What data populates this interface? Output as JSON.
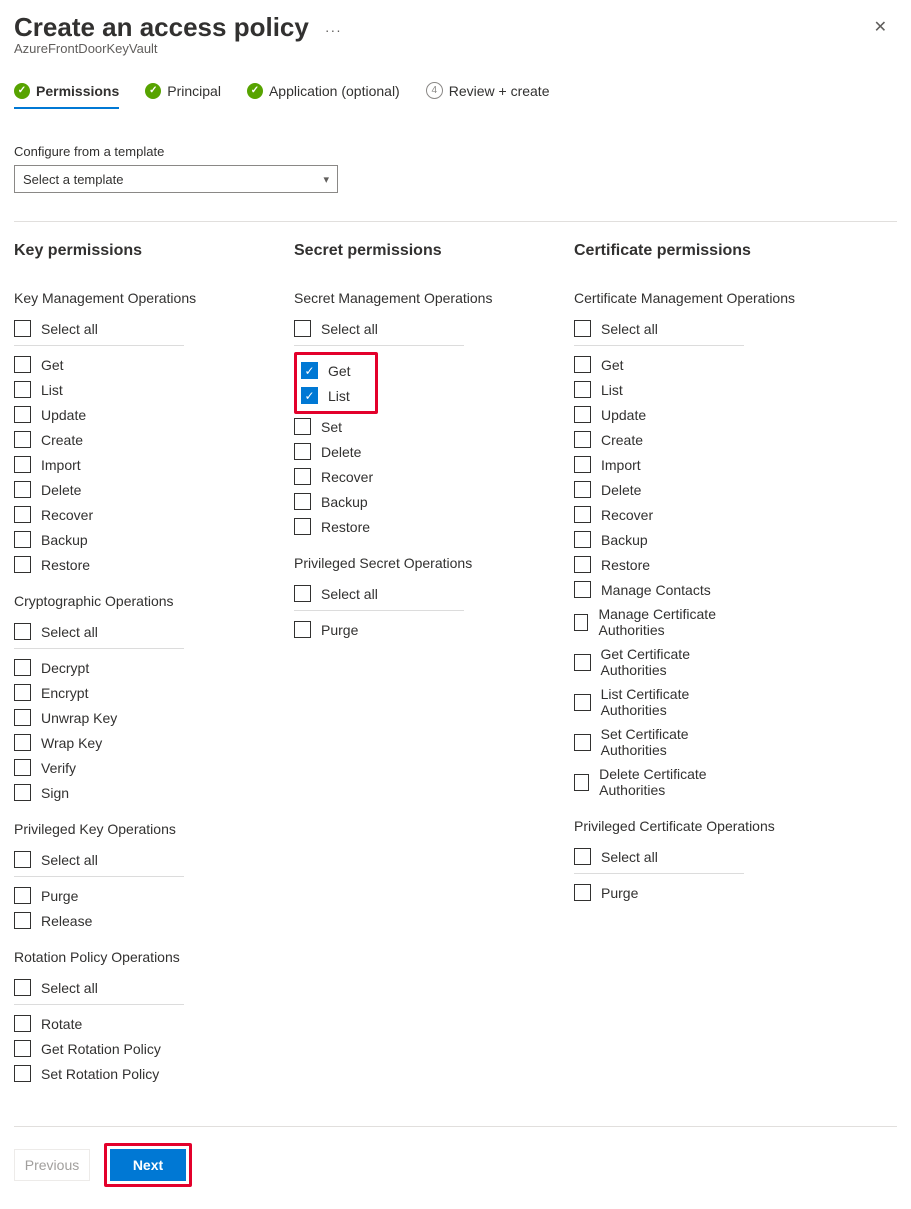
{
  "header": {
    "title": "Create an access policy",
    "subtitle": "AzureFrontDoorKeyVault"
  },
  "tabs": [
    {
      "label": "Permissions",
      "state": "done",
      "active": true
    },
    {
      "label": "Principal",
      "state": "done",
      "active": false
    },
    {
      "label": "Application (optional)",
      "state": "done",
      "active": false
    },
    {
      "label": "Review + create",
      "state": "pending",
      "num": "4",
      "active": false
    }
  ],
  "template": {
    "label": "Configure from a template",
    "select_placeholder": "Select a template"
  },
  "columns": {
    "key": {
      "title": "Key permissions",
      "groups": [
        {
          "title": "Key Management Operations",
          "select_all": "Select all",
          "items": [
            {
              "label": "Get",
              "checked": false
            },
            {
              "label": "List",
              "checked": false
            },
            {
              "label": "Update",
              "checked": false
            },
            {
              "label": "Create",
              "checked": false
            },
            {
              "label": "Import",
              "checked": false
            },
            {
              "label": "Delete",
              "checked": false
            },
            {
              "label": "Recover",
              "checked": false
            },
            {
              "label": "Backup",
              "checked": false
            },
            {
              "label": "Restore",
              "checked": false
            }
          ]
        },
        {
          "title": "Cryptographic Operations",
          "select_all": "Select all",
          "items": [
            {
              "label": "Decrypt",
              "checked": false
            },
            {
              "label": "Encrypt",
              "checked": false
            },
            {
              "label": "Unwrap Key",
              "checked": false
            },
            {
              "label": "Wrap Key",
              "checked": false
            },
            {
              "label": "Verify",
              "checked": false
            },
            {
              "label": "Sign",
              "checked": false
            }
          ]
        },
        {
          "title": "Privileged Key Operations",
          "select_all": "Select all",
          "items": [
            {
              "label": "Purge",
              "checked": false
            },
            {
              "label": "Release",
              "checked": false
            }
          ]
        },
        {
          "title": "Rotation Policy Operations",
          "select_all": "Select all",
          "items": [
            {
              "label": "Rotate",
              "checked": false
            },
            {
              "label": "Get Rotation Policy",
              "checked": false
            },
            {
              "label": "Set Rotation Policy",
              "checked": false
            }
          ]
        }
      ]
    },
    "secret": {
      "title": "Secret permissions",
      "groups": [
        {
          "title": "Secret Management Operations",
          "select_all": "Select all",
          "highlight": true,
          "items": [
            {
              "label": "Get",
              "checked": true
            },
            {
              "label": "List",
              "checked": true
            },
            {
              "label": "Set",
              "checked": false
            },
            {
              "label": "Delete",
              "checked": false
            },
            {
              "label": "Recover",
              "checked": false
            },
            {
              "label": "Backup",
              "checked": false
            },
            {
              "label": "Restore",
              "checked": false
            }
          ],
          "highlight_count": 2
        },
        {
          "title": "Privileged Secret Operations",
          "select_all": "Select all",
          "items": [
            {
              "label": "Purge",
              "checked": false
            }
          ]
        }
      ]
    },
    "cert": {
      "title": "Certificate permissions",
      "groups": [
        {
          "title": "Certificate Management Operations",
          "select_all": "Select all",
          "items": [
            {
              "label": "Get",
              "checked": false
            },
            {
              "label": "List",
              "checked": false
            },
            {
              "label": "Update",
              "checked": false
            },
            {
              "label": "Create",
              "checked": false
            },
            {
              "label": "Import",
              "checked": false
            },
            {
              "label": "Delete",
              "checked": false
            },
            {
              "label": "Recover",
              "checked": false
            },
            {
              "label": "Backup",
              "checked": false
            },
            {
              "label": "Restore",
              "checked": false
            },
            {
              "label": "Manage Contacts",
              "checked": false
            },
            {
              "label": "Manage Certificate Authorities",
              "checked": false
            },
            {
              "label": "Get Certificate Authorities",
              "checked": false
            },
            {
              "label": "List Certificate Authorities",
              "checked": false
            },
            {
              "label": "Set Certificate Authorities",
              "checked": false
            },
            {
              "label": "Delete Certificate Authorities",
              "checked": false
            }
          ]
        },
        {
          "title": "Privileged Certificate Operations",
          "select_all": "Select all",
          "items": [
            {
              "label": "Purge",
              "checked": false
            }
          ]
        }
      ]
    }
  },
  "footer": {
    "previous": "Previous",
    "next": "Next"
  }
}
